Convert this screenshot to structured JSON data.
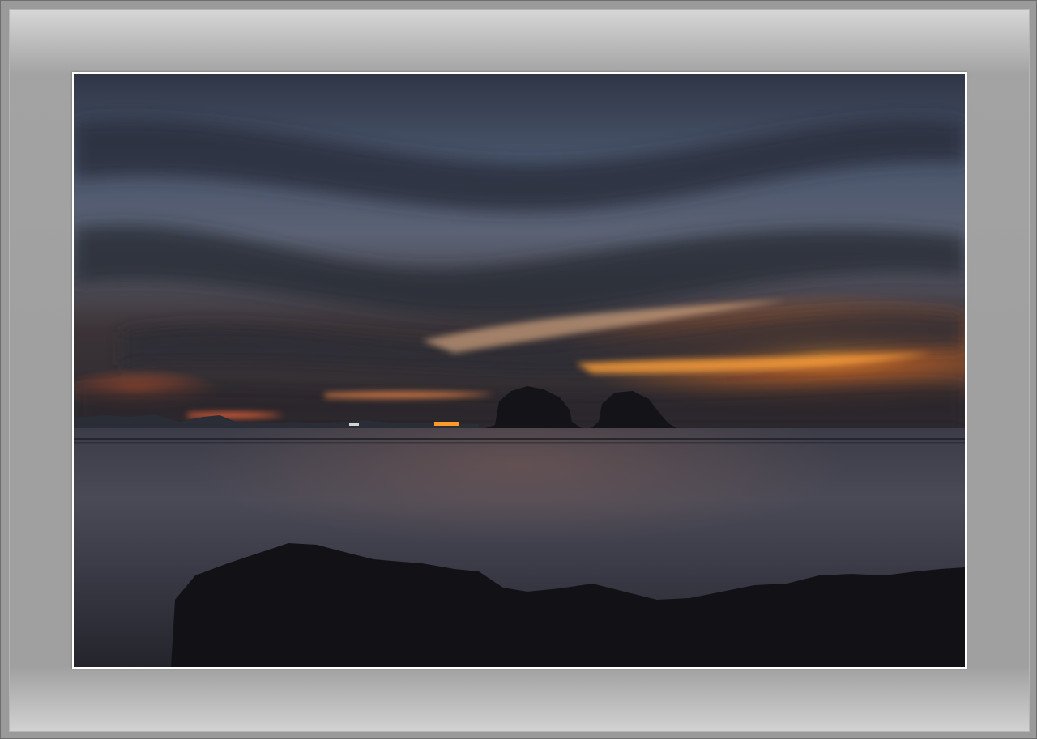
{
  "image": {
    "subject": "",
    "colors": {
      "frame": "#9a9a9a",
      "mat_light": "#d7d7d7",
      "mat_mid": "#a0a0a0",
      "sky_top": "#3a4050",
      "sky_mid": "#5a6478",
      "glow": "#f07a20",
      "sea": "#3a3a44"
    }
  }
}
